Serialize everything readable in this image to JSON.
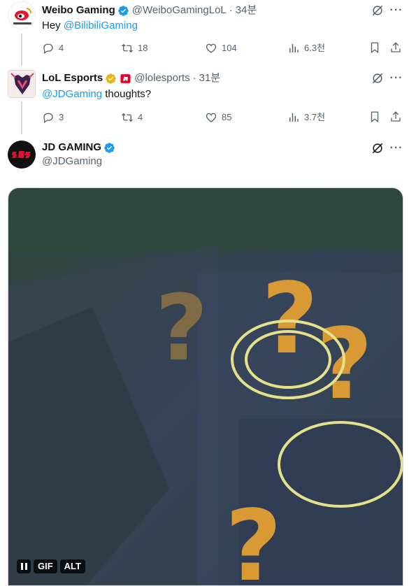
{
  "tweets": [
    {
      "name": "Weibo Gaming",
      "handle": "@WeiboGamingLoL",
      "time": "34분",
      "text_prefix": "Hey ",
      "mention": "@BilibiliGaming",
      "text_suffix": "",
      "verified": "blue",
      "stats": {
        "replies": "4",
        "retweets": "18",
        "likes": "104",
        "views": "6.3천"
      }
    },
    {
      "name": "LoL Esports",
      "handle": "@lolesports",
      "time": "31분",
      "text_prefix": "",
      "mention": "@JDGaming",
      "text_suffix": " thoughts?",
      "verified": "gold",
      "affiliate_badge": "riot-games-affiliate-icon",
      "stats": {
        "replies": "3",
        "retweets": "4",
        "likes": "85",
        "views": "3.7천"
      }
    },
    {
      "name": "JD GAMING",
      "handle": "@JDGaming",
      "verified": "blue",
      "media": {
        "type": "gif",
        "gif_label": "GIF",
        "alt_label": "ALT"
      }
    }
  ],
  "icons": {
    "reply": "reply-icon",
    "retweet": "retweet-icon",
    "like": "heart-icon",
    "views": "views-icon",
    "bookmark": "bookmark-icon",
    "share": "share-icon",
    "grok": "grok-icon",
    "more": "more-icon"
  },
  "colors": {
    "accent": "#1d9bf0",
    "secondary_text": "#536471",
    "verified_blue": "#1d9bf0",
    "verified_gold": "#e2b719"
  }
}
